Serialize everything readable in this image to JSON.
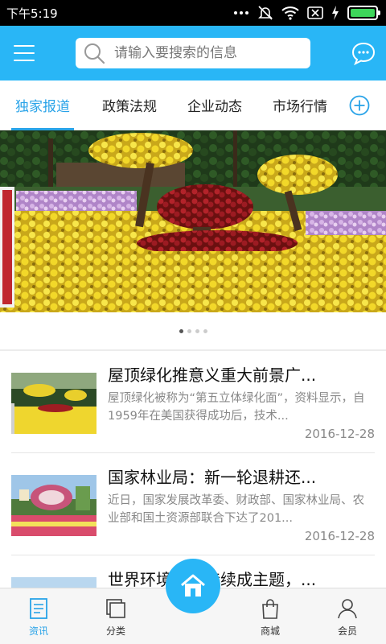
{
  "status": {
    "time": "下午5:19",
    "battery_level": 1.0
  },
  "header": {
    "search_placeholder": "请输入要搜索的信息"
  },
  "tabs": [
    {
      "label": "独家报道",
      "active": true
    },
    {
      "label": "政策法规",
      "active": false
    },
    {
      "label": "企业动态",
      "active": false
    },
    {
      "label": "市场行情",
      "active": false
    }
  ],
  "carousel": {
    "count": 4,
    "active_index": 0
  },
  "news": [
    {
      "title": "屋顶绿化推意义重大前景广...",
      "summary": "屋顶绿化被称为“第五立体绿化面”，资料显示，自1959年在美国获得成功后，技术...",
      "date": "2016-12-28"
    },
    {
      "title": "国家林业局：新一轮退耕还...",
      "summary": "近日，国家发展改革委、财政部、国家林业局、农业部和国土资源部联合下达了201...",
      "date": "2016-12-28"
    },
    {
      "title": "世界环境日可持续成主题，...",
      "summary": "",
      "date": ""
    }
  ],
  "nav": {
    "news": "资讯",
    "category": "分类",
    "shop": "商城",
    "member": "会员"
  },
  "colors": {
    "accent": "#29b6f6",
    "tab_active": "#29a3e8"
  }
}
